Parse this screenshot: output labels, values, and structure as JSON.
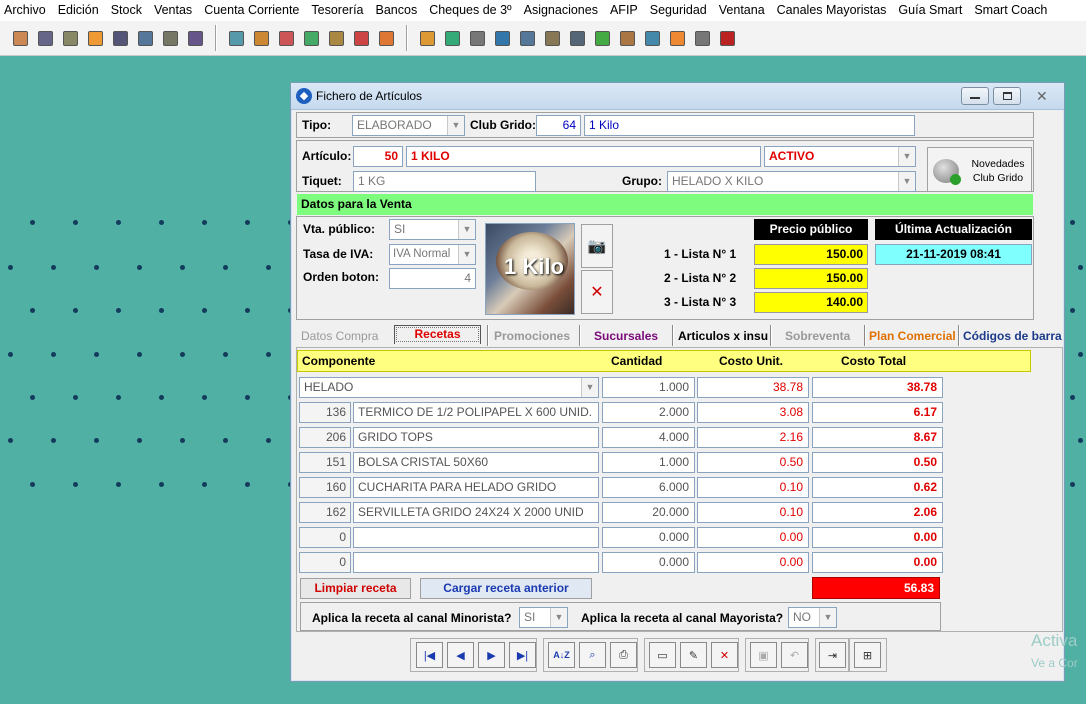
{
  "menu": [
    "Archivo",
    "Edición",
    "Stock",
    "Ventas",
    "Cuenta Corriente",
    "Tesorería",
    "Bancos",
    "Cheques de 3º",
    "Asignaciones",
    "AFIP",
    "Seguridad",
    "Ventana",
    "Canales Mayoristas",
    "Guía Smart",
    "Smart Coach"
  ],
  "toolbar_icons": [
    "import-icon",
    "list-icon",
    "clipboard-icon",
    "document-icon",
    "chart-icon",
    "report-icon",
    "printer-icon",
    "transfer-icon",
    "box-icon",
    "box-icon",
    "box-icon",
    "box-icon",
    "box-icon",
    "box-icon",
    "box-icon",
    "user-icon",
    "money-icon",
    "calc-icon",
    "search-icon",
    "config-icon",
    "bank-icon",
    "stack-icon",
    "card-icon",
    "safe-icon",
    "op-icon",
    "receipt-icon",
    "bell-icon",
    "power-icon"
  ],
  "window": {
    "title": "Fichero de Artículos"
  },
  "header": {
    "tipo_label": "Tipo:",
    "tipo_value": "ELABORADO",
    "club_label": "Club Grido:",
    "club_code": "64",
    "club_desc": "1 Kilo",
    "articulo_label": "Artículo:",
    "articulo_code": "50",
    "articulo_name": "1 KILO",
    "estado": "ACTIVO",
    "tiquet_label": "Tiquet:",
    "tiquet_value": "1 KG",
    "grupo_label": "Grupo:",
    "grupo_value": "HELADO X  KILO",
    "novedades_label_1": "Novedades",
    "novedades_label_2": "Club Grido"
  },
  "venta": {
    "section_title": "Datos para la Venta",
    "vta_publico_label": "Vta. público:",
    "vta_publico_value": "SI",
    "iva_label": "Tasa de IVA:",
    "iva_value": "IVA Normal",
    "orden_label": "Orden boton:",
    "orden_value": "4",
    "photo_caption": "1 Kilo",
    "precio_header": "Precio público",
    "actualizacion_header": "Última Actualización",
    "actualizacion_value": "21-11-2019 08:41",
    "listas": [
      {
        "label": "1 - Lista N° 1",
        "value": "150.00"
      },
      {
        "label": "2 - Lista N° 2",
        "value": "150.00"
      },
      {
        "label": "3 - Lista N° 3",
        "value": "140.00"
      }
    ]
  },
  "tabs": [
    "Datos Compra",
    "Recetas",
    "Promociones",
    "Sucursales",
    "Articulos x insu",
    "Sobreventa",
    "Plan Comercial",
    "Códigos de barra"
  ],
  "colors": {
    "tab_sucursales": "#7a0a7a",
    "tab_plan": "#e07000",
    "tab_codigos": "#1b3a8a",
    "tab_recetas": "#e00000"
  },
  "receta": {
    "headers": {
      "componente": "Componente",
      "cantidad": "Cantidad",
      "costo_unit": "Costo Unit.",
      "costo_total": "Costo Total"
    },
    "first_row": {
      "desc": "HELADO",
      "qty": "1.000",
      "unit": "38.78",
      "total": "38.78"
    },
    "rows": [
      {
        "code": "136",
        "desc": "TERMICO DE 1/2 POLIPAPEL X 600 UNID.",
        "qty": "2.000",
        "unit": "3.08",
        "total": "6.17"
      },
      {
        "code": "206",
        "desc": "GRIDO TOPS",
        "qty": "4.000",
        "unit": "2.16",
        "total": "8.67"
      },
      {
        "code": "151",
        "desc": "BOLSA CRISTAL 50X60",
        "qty": "1.000",
        "unit": "0.50",
        "total": "0.50"
      },
      {
        "code": "160",
        "desc": "CUCHARITA PARA HELADO GRIDO",
        "qty": "6.000",
        "unit": "0.10",
        "total": "0.62"
      },
      {
        "code": "162",
        "desc": "SERVILLETA GRIDO 24X24 X 2000 UNID",
        "qty": "20.000",
        "unit": "0.10",
        "total": "2.06"
      },
      {
        "code": "0",
        "desc": "",
        "qty": "0.000",
        "unit": "0.00",
        "total": "0.00"
      },
      {
        "code": "0",
        "desc": "",
        "qty": "0.000",
        "unit": "0.00",
        "total": "0.00"
      }
    ],
    "total": "56.83",
    "limpiar_label": "Limpiar receta",
    "cargar_label": "Cargar receta anterior",
    "minorista_label": "Aplica la receta al canal Minorista?",
    "minorista_value": "SI",
    "mayorista_label": "Aplica la receta al canal Mayorista?",
    "mayorista_value": "NO"
  },
  "watermark": {
    "line1": "Activa",
    "line2": "Ve a Cor"
  }
}
